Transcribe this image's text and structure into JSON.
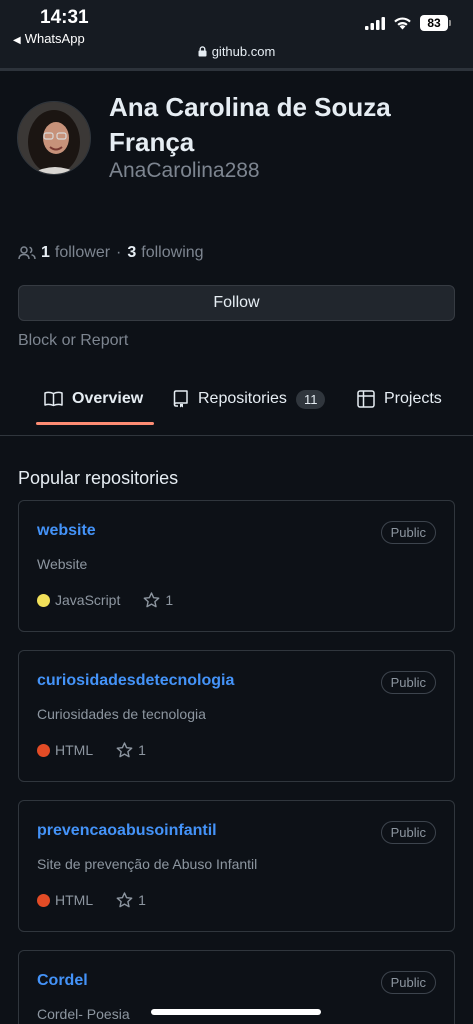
{
  "status_bar": {
    "time": "14:31",
    "back_app": "WhatsApp",
    "battery": "83",
    "url": "github.com"
  },
  "profile": {
    "name": "Ana Carolina de Souza França",
    "login": "AnaCarolina288",
    "followers_count": "1",
    "followers_label": "follower",
    "following_count": "3",
    "following_label": "following",
    "follow_button": "Follow",
    "block_link": "Block or Report"
  },
  "tabs": [
    {
      "label": "Overview",
      "icon": "book-icon",
      "active": true
    },
    {
      "label": "Repositories",
      "icon": "repo-icon",
      "count": "11"
    },
    {
      "label": "Projects",
      "icon": "table-icon"
    }
  ],
  "section_title": "Popular repositories",
  "repos": [
    {
      "name": "website",
      "visibility": "Public",
      "description": "Website",
      "language": "JavaScript",
      "language_color": "#f1e05a",
      "stars": "1"
    },
    {
      "name": "curiosidadesdetecnologia",
      "visibility": "Public",
      "description": "Curiosidades de tecnologia",
      "language": "HTML",
      "language_color": "#e34c26",
      "stars": "1"
    },
    {
      "name": "prevencaoabusoinfantil",
      "visibility": "Public",
      "description": "Site de prevenção de Abuso Infantil",
      "language": "HTML",
      "language_color": "#e34c26",
      "stars": "1"
    },
    {
      "name": "Cordel",
      "visibility": "Public",
      "description": "Cordel- Poesia"
    }
  ],
  "colors": {
    "background": "#0d1117",
    "link": "#4493f8",
    "tab_underline": "#fd8c73"
  }
}
